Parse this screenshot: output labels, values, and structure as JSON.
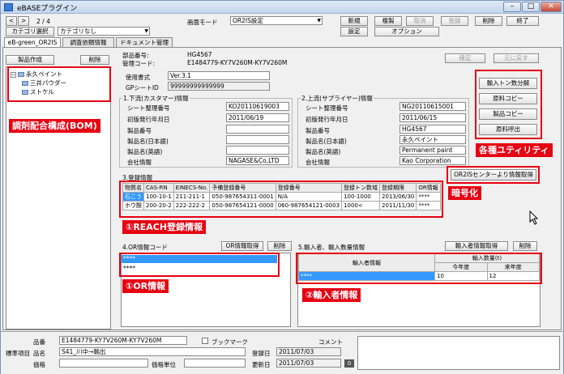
{
  "window": {
    "title": "eBASEプラグイン",
    "min": "–",
    "max": "□",
    "close": "✕"
  },
  "nav": {
    "page": "2 / 4",
    "category_label": "カテゴリ選択",
    "category_value": "カテゴリなし",
    "screen_mode_label": "画面モード",
    "screen_mode_value": "OR2IS設定"
  },
  "toolbar": {
    "new": "新規",
    "copy": "複製",
    "cancel": "取消",
    "register": "登録",
    "delete": "削除",
    "exit": "終了",
    "settings": "設定",
    "options": "オプション"
  },
  "tabs": [
    "eB-green_OR2IS",
    "調査依頼情報",
    "ドキュメント管理"
  ],
  "left": {
    "create": "製品作成",
    "delete": "削除",
    "tree": {
      "root": "永久ペイント",
      "child1": "三井パウダー",
      "child2": "ストケル"
    }
  },
  "header": {
    "part_no_label": "部品番号:",
    "part_no": "HG4567",
    "mgmt_code_label": "管理コード:",
    "mgmt_code": "E1484779-KY7V260M-KY7V260M",
    "confirm": "確定",
    "restore": "元に戻す"
  },
  "form": {
    "format_label": "使用書式",
    "format_value": "Ver.3.1",
    "gp_label": "GPシートID",
    "gp_value": "99999999999999"
  },
  "downstream": {
    "title": "1.下流(カスタマー)情報",
    "sheet_no_label": "シート整理番号",
    "sheet_no": "KO20110619003",
    "first_date_label": "初版発行年月日",
    "first_date": "2011/06/19",
    "product_no_label": "製品番号",
    "product_no": "",
    "product_name_jp_label": "製品名(日本語)",
    "product_name_jp": "",
    "product_name_en_label": "製品名(英語)",
    "product_name_en": "",
    "company_label": "会社情報",
    "company": "NAGASE&Co,LTD"
  },
  "upstream": {
    "title": "2.上流(サプライヤー)情報",
    "sheet_no_label": "シート整理番号",
    "sheet_no": "NG20110615001",
    "first_date_label": "初版発行年月日",
    "first_date": "2011/06/15",
    "product_no_label": "製品番号",
    "product_no": "HG4567",
    "product_name_jp_label": "製品名(日本語)",
    "product_name_jp": "永久ペイント",
    "product_name_en_label": "製品名(英語)",
    "product_name_en": "Permanent paint",
    "company_label": "会社情報",
    "company": "Kao Corporation"
  },
  "utilities": {
    "import_split": "輸入トン数分解",
    "raw_copy": "原料コピー",
    "product_copy": "製品コピー",
    "raw_call": "原料呼出"
  },
  "registration": {
    "title": "3.登録情報",
    "fetch": "OR2ISセンターより情報取得",
    "headers": [
      "物質名",
      "CAS-RN",
      "EINECS-No.",
      "予備登録番号",
      "登録番号",
      "登録トン数域",
      "登録期限",
      "OR情報"
    ],
    "rows": [
      [
        "石こう",
        "100-10-1",
        "211-211-1",
        "050-987654311-0001",
        "N/A",
        "100-1000",
        "2013/06/30",
        "****"
      ],
      [
        "ホウ酸",
        "200-20-2",
        "222-222-2",
        "050-987654121-0000",
        "060-987654121-0003",
        "1000<",
        "2011/11/30",
        "****"
      ]
    ]
  },
  "or_info": {
    "title": "4.OR情報コード",
    "fetch": "OR情報取得",
    "delete": "削除",
    "rows": [
      "****",
      "****"
    ]
  },
  "importer": {
    "title": "5.輸入者、輸入数量情報",
    "fetch": "輸入者情報取得",
    "delete": "削除",
    "col_info": "輸入者情報",
    "col_qty": "輸入数量(t)",
    "col_this_year": "今年度",
    "col_next_year": "来年度",
    "row": {
      "name": "****",
      "this_year": "10",
      "next_year": "12"
    }
  },
  "status": {
    "part_label": "品番",
    "part_value": "E1484779-KY7V260M-KY7V260M",
    "bookmark": "ブックマーク",
    "comment": "コメント",
    "std_label": "標準項目",
    "item_label": "品名",
    "item_value": "S41_川中→輸出",
    "reg_date_label": "登録日",
    "reg_date": "2011/07/03",
    "price_label": "価格",
    "unit_label": "価格単位",
    "upd_date_label": "更新日",
    "upd_date": "2011/07/03",
    "counter": "0"
  },
  "annotations": {
    "bom": "調剤配合構成(BOM)",
    "utilities": "各種ユティリティ",
    "encrypt": "暗号化",
    "reach": "①REACH登録情報",
    "or": "①OR情報",
    "importer": "②輸入者情報"
  },
  "colors": {
    "annotation_red": "#e60012",
    "selection_blue": "#3399ff"
  }
}
